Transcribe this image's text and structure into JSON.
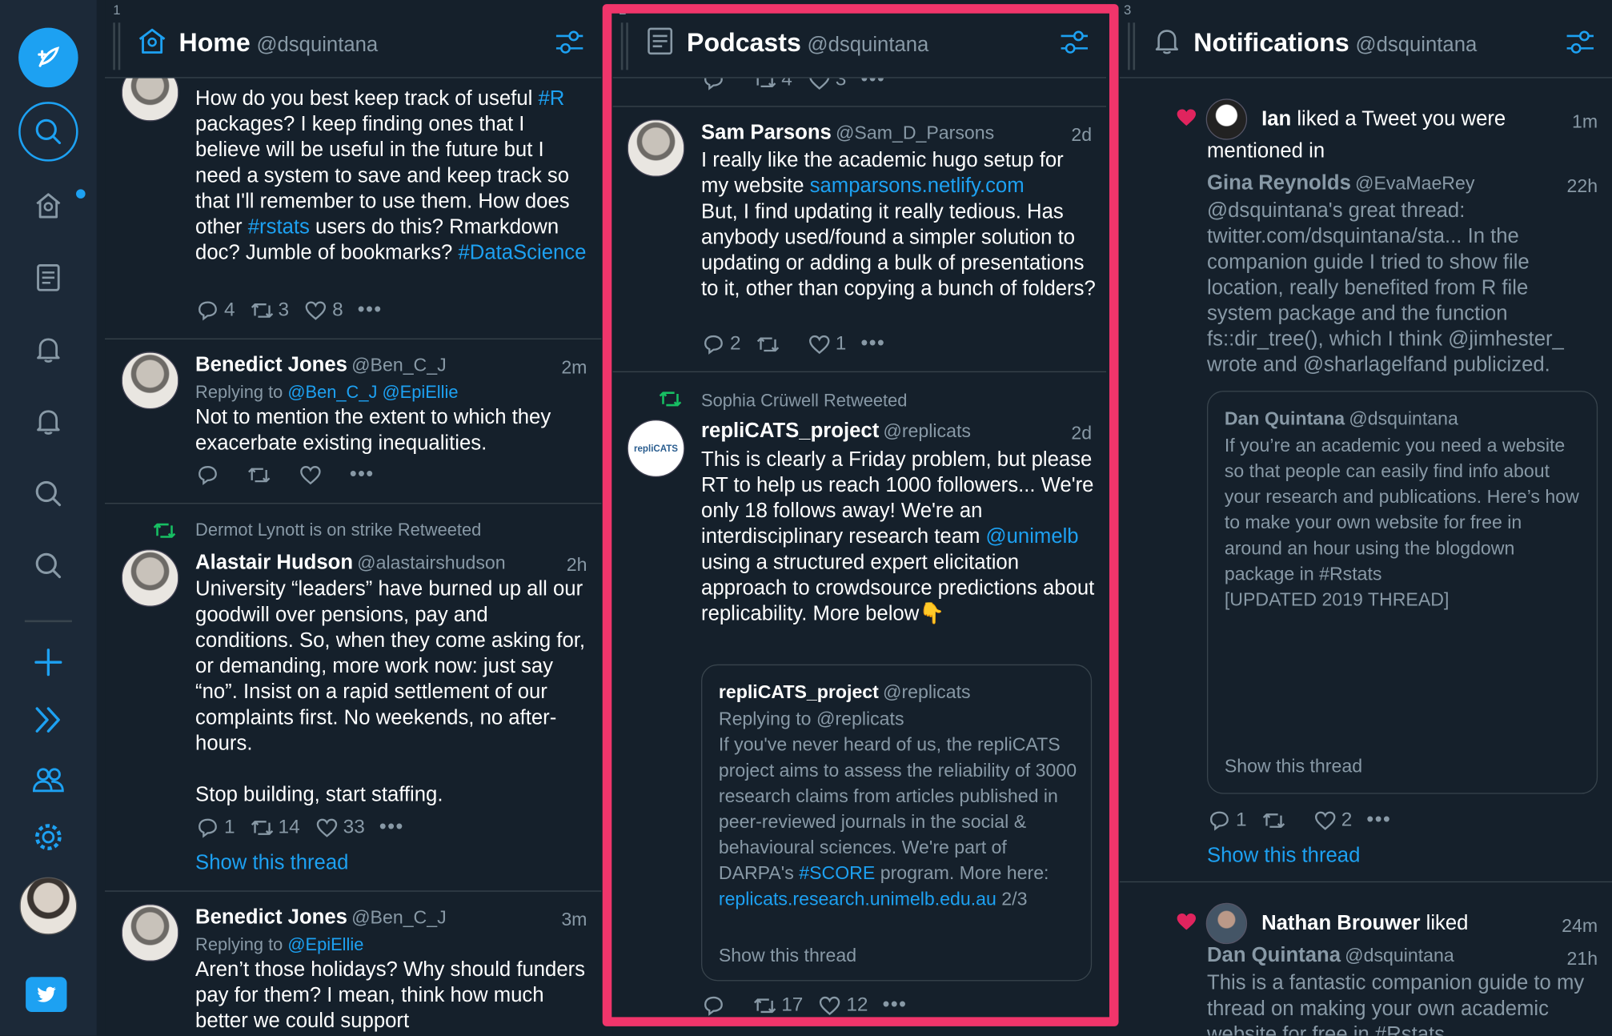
{
  "colors": {
    "accent": "#1da1f2",
    "highlight": "#f0356b",
    "retweet": "#17bf63",
    "like": "#e0245e"
  },
  "sidebar": {
    "items": [
      "compose-icon",
      "search-icon",
      "home-icon",
      "list-icon",
      "notifications-icon",
      "notifications-icon",
      "search-icon",
      "search-icon",
      "add-icon",
      "expand-icon",
      "people-icon",
      "settings-icon",
      "avatar",
      "twitter-bird-icon"
    ]
  },
  "columns": {
    "home": {
      "num": "1",
      "title": "Home",
      "user": "@dsquintana"
    },
    "podcasts": {
      "num": "2",
      "title": "Podcasts",
      "user": "@dsquintana"
    },
    "notifications": {
      "num": "3",
      "title": "Notifications",
      "user": "@dsquintana"
    }
  },
  "home": {
    "t1": {
      "text_a": "How do you best keep track of useful ",
      "tag1": "#R",
      "text_b": " packages? I keep finding ones that I believe will be useful in the future but I need a system to save and keep track so that I'll remember to use them. How does other ",
      "tag2": "#rstats",
      "text_c": " users do this? Rmarkdown doc? Jumble of bookmarks? ",
      "tag3": "#DataScience",
      "replies": "4",
      "retweets": "3",
      "likes": "8"
    },
    "t2": {
      "name": "Benedict Jones",
      "handle": "@Ben_C_J",
      "time": "2m",
      "reply_label": "Replying to ",
      "reply_a": "@Ben_C_J",
      "reply_b": "@EpiEllie",
      "text": "Not to mention the extent to which they exacerbate existing inequalities."
    },
    "t3": {
      "retweeted_by": "Dermot Lynott is on strike Retweeted",
      "name": "Alastair Hudson",
      "handle": "@alastairshudson",
      "time": "2h",
      "text": "University “leaders” have burned up all our goodwill over pensions, pay and conditions. So, when they come asking for, or demanding, more work now: just say “no”. Insist on a rapid settlement of our complaints first. No weekends, no after-hours.\n\nStop building, start staffing.",
      "replies": "1",
      "retweets": "14",
      "likes": "33",
      "show_thread": "Show this thread"
    },
    "t4": {
      "name": "Benedict Jones",
      "handle": "@Ben_C_J",
      "time": "3m",
      "reply_label": "Replying to ",
      "reply_a": "@EpiEllie",
      "text": "Aren’t those holidays? Why should funders pay for them? I mean, think how much better we could support"
    }
  },
  "podcasts": {
    "t0": {
      "retweets": "4",
      "likes": "3"
    },
    "t1": {
      "name": "Sam Parsons",
      "handle": "@Sam_D_Parsons",
      "time": "2d",
      "text_a": "I really like the academic hugo setup for my website ",
      "link": "samparsons.netlify.com",
      "text_b": "\nBut, I find updating it really tedious. Has anybody used/found a simpler solution to updating or adding a bulk of presentations to it, other than copying a bunch of folders?",
      "replies": "2",
      "likes": "1"
    },
    "t2": {
      "retweeted_by": "Sophia Crüwell Retweeted",
      "avatar_text": "repliCATS",
      "name": "repliCATS_project",
      "handle": "@replicats",
      "time": "2d",
      "text_a": "This is clearly a Friday problem, but please RT to help us reach 1000 followers... We're only 18 follows away! We're an interdisciplinary research team ",
      "link": "@unimelb",
      "text_b": " using a structured expert elicitation approach to crowdsource predictions about replicability. More below👇",
      "quote": {
        "name": "repliCATS_project",
        "handle": "@replicats",
        "reply": "Replying to @replicats",
        "text_a": "If you've never heard of us, the repliCATS project aims to assess the reliability of 3000 research claims from articles published in peer-reviewed journals in the social & behavioural sciences. We're part of DARPA's ",
        "tag": "#SCORE",
        "text_b": " program. More here: ",
        "link": "replicats.research.unimelb.edu.au",
        "text_c": " 2/3",
        "show_thread": "Show this thread"
      },
      "retweets": "17",
      "likes": "12"
    }
  },
  "notifications": {
    "n1": {
      "actor": "Ian",
      "action": " liked a Tweet you were mentioned in",
      "time": "1m",
      "name": "Gina Reynolds",
      "handle": "@EvaMaeRey",
      "tweet_time": "22h",
      "text": "@dsquintana's great thread: twitter.com/dsquintana/sta...  In the companion guide I tried to show file location, really benefited from R file system package and the function fs::dir_tree(), which I think @jimhester_  wrote and @sharlagelfand publicized.",
      "quote": {
        "name": "Dan Quintana",
        "handle": "@dsquintana",
        "text": "If you’re an academic you need a website so that people can easily find info about your research and publications. Here’s how to make your own website for free in around an hour using the blogdown package in #Rstats\n [UPDATED 2019 THREAD]",
        "show_thread": "Show this thread"
      },
      "replies": "1",
      "likes": "2",
      "show_thread": "Show this thread"
    },
    "n2": {
      "actor": "Nathan Brouwer",
      "action": " liked",
      "time": "24m",
      "name": "Dan Quintana",
      "handle": "@dsquintana",
      "tweet_time": "21h",
      "text": "This is a fantastic companion guide to my thread on making your own academic website for free in #Rstats"
    }
  }
}
